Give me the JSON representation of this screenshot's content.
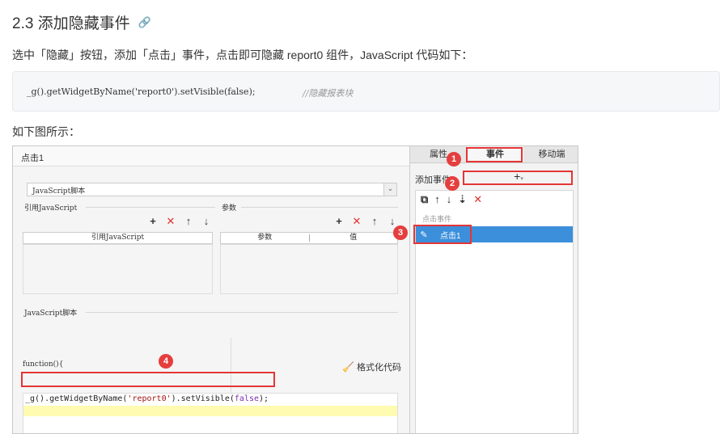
{
  "doc": {
    "title": "2.3 添加隐藏事件",
    "intro": "选中「隐藏」按钮，添加「点击」事件，点击即可隐藏 report0 组件，JavaScript 代码如下：",
    "code": "_g().getWidgetByName('report0').setVisible(false);",
    "code_comment": "//隐藏报表块",
    "caption": "如下图所示："
  },
  "app": {
    "left_title": "点击1",
    "script_select": "JavaScript脚本",
    "ref_label": "引用JavaScript",
    "param_label": "参数",
    "ref_col": "引用JavaScript",
    "param_col": "参数",
    "value_col": "值",
    "script_section": "JavaScript脚本",
    "function_text": "function(){",
    "format_btn": "格式化代码",
    "editor": {
      "p1": "_g().getWidgetByName(",
      "p2": "'report0'",
      "p3": ").setVisible(",
      "p4": "false",
      "p5": ");"
    },
    "tabs": [
      "属性",
      "事件",
      "移动端"
    ],
    "add_event_label": "添加事件",
    "event_group": "点击事件",
    "event_item": "点击1"
  },
  "markers": [
    "1",
    "2",
    "3",
    "4"
  ],
  "colors": {
    "highlight": "#e53535",
    "selected": "#3c8fdb"
  }
}
